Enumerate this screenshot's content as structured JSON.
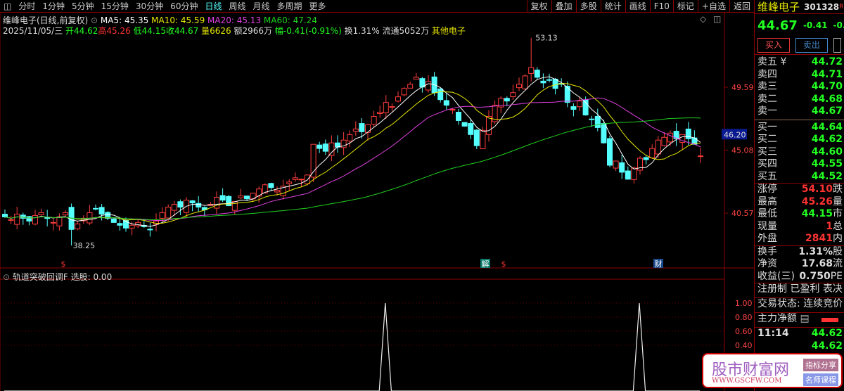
{
  "toolbar": {
    "periods": [
      "分时",
      "1分钟",
      "5分钟",
      "15分钟",
      "30分钟",
      "60分钟",
      "日线",
      "周线",
      "月线",
      "多周期",
      "更多"
    ],
    "active": "日线",
    "buttons": [
      "复权",
      "叠加",
      "多股",
      "统计",
      "画线",
      "F10",
      "标记",
      "+自选",
      "返回"
    ]
  },
  "header": {
    "title": "维峰电子(日线,前复权)",
    "ma5": "MA5: 45.35",
    "ma10": "MA10: 45.59",
    "ma20": "MA20: 45.13",
    "ma60": "MA60: 47.24",
    "date": "2025/11/05/三",
    "open": "开44.62",
    "high": "高45.26",
    "low": "低44.15",
    "close": "收44.67",
    "volume": "量6626",
    "amount": "额2966万",
    "change": "幅-0.41(-0.91%)",
    "turnover": "换1.31%",
    "float": "流通5052万",
    "sector": "其他电子"
  },
  "colors": {
    "up": "#ff3c3c",
    "down": "#54ffff",
    "ma5": "#ffffff",
    "ma10": "#e8e800",
    "ma20": "#e040e0",
    "ma60": "#20d020",
    "grid_red": "#8b0000"
  },
  "chart_data": {
    "type": "candlestick",
    "price_axis_ticks": [
      "49.59",
      "45.08",
      "40.57"
    ],
    "current_marker": "46.20",
    "close": [
      40.3,
      40.1,
      40.5,
      40.2,
      40.0,
      40.4,
      40.6,
      40.2,
      39.9,
      40.3,
      40.6,
      39.4,
      39.8,
      40.2,
      40.6,
      40.9,
      40.5,
      40.2,
      39.9,
      39.7,
      39.5,
      39.7,
      39.9,
      39.6,
      39.4,
      40.0,
      40.6,
      41.0,
      41.2,
      41.0,
      41.5,
      41.3,
      41.0,
      40.8,
      41.2,
      41.7,
      41.5,
      41.1,
      41.4,
      41.8,
      41.6,
      42.0,
      42.3,
      42.6,
      42.4,
      42.2,
      42.5,
      42.8,
      43.1,
      43.0,
      43.3,
      45.5,
      45.2,
      45.0,
      45.6,
      45.3,
      45.8,
      46.2,
      46.6,
      46.4,
      46.9,
      47.5,
      47.8,
      48.5,
      48.2,
      48.9,
      49.5,
      49.8,
      50.3,
      49.6,
      50.0,
      49.2,
      48.7,
      48.3,
      48.0,
      47.2,
      46.8,
      46.2,
      45.4,
      46.5,
      47.5,
      48.3,
      48.8,
      48.6,
      49.2,
      49.8,
      50.4,
      51.0,
      50.3,
      49.9,
      50.1,
      49.5,
      49.8,
      48.5,
      48.0,
      48.6,
      47.6,
      47.3,
      46.7,
      45.6,
      44.0,
      44.3,
      43.5,
      43.0,
      43.8,
      44.5,
      44.4,
      45.2,
      45.8,
      46.0,
      46.3,
      45.9,
      46.2,
      45.9,
      45.5,
      44.67
    ],
    "annotations": {
      "high_label": "53.13",
      "low_label": "38.25"
    },
    "event_markers": [
      "$",
      "解",
      "$",
      "财"
    ],
    "indicator": {
      "title": "轨道突破回调F",
      "value": "选股: 0.00",
      "ticks": [
        "1.00",
        "0.80",
        "0.60",
        "0.40"
      ],
      "signals": [
        63,
        105
      ]
    }
  },
  "quote": {
    "name": "维峰电子",
    "code": "301328",
    "badge": "R",
    "price": "44.67",
    "change": "-0.41",
    "pct": "-0.91",
    "buy": "买入",
    "sell": "卖出",
    "asks": [
      {
        "l": "卖五 ¥",
        "p": "44.72"
      },
      {
        "l": "卖四",
        "p": "44.71"
      },
      {
        "l": "卖三",
        "p": "44.70"
      },
      {
        "l": "卖二",
        "p": "44.68"
      },
      {
        "l": "卖一",
        "p": "44.67"
      }
    ],
    "bids": [
      {
        "l": "买一",
        "p": "44.64"
      },
      {
        "l": "买二",
        "p": "44.62"
      },
      {
        "l": "买三",
        "p": "44.60"
      },
      {
        "l": "买四",
        "p": "44.55"
      },
      {
        "l": "买五",
        "p": "44.52"
      }
    ],
    "stats1": [
      {
        "l": "涨停",
        "v": "54.10",
        "c": "r",
        "x": "跌"
      },
      {
        "l": "最高",
        "v": "45.26",
        "c": "r",
        "x": "量"
      },
      {
        "l": "最低",
        "v": "44.15",
        "c": "g",
        "x": "市"
      },
      {
        "l": "现量",
        "v": "1",
        "c": "r",
        "x": "总"
      },
      {
        "l": "外盘",
        "v": "2841",
        "c": "r",
        "x": "内"
      }
    ],
    "stats2": [
      {
        "l": "换手",
        "v": "1.31%",
        "x": "股"
      },
      {
        "l": "净资",
        "v": "17.68",
        "x": "流"
      },
      {
        "l": "收益(三)",
        "v": "0.750",
        "x": "PE"
      }
    ],
    "tags": "注册制 已盈利 表决",
    "status": "交易状态: 连续竞价",
    "main_flow": "主力净额",
    "ticks": [
      {
        "t": "11:14",
        "p": "44.62"
      },
      {
        "t": "",
        "p": "44.62"
      }
    ]
  },
  "watermark": {
    "name": "股市财富网",
    "url": "WWW.GSCFW.COM",
    "tag1": "指标分享",
    "tag2": "名师课程"
  }
}
